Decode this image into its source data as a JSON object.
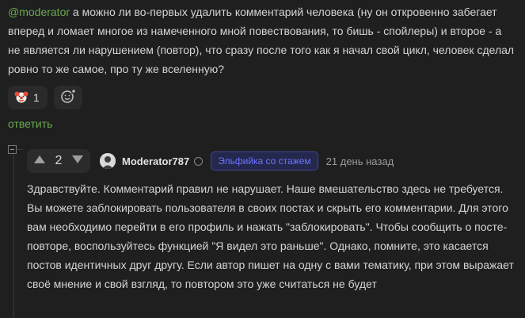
{
  "parent_comment": {
    "mention": "@moderator",
    "text": " а можно ли во-первых удалить комментарий человека (ну он откровенно забегает вперед и ломает многое из намеченного мной повествования, то бишь - спойлеры) и второе - а не является ли нарушением (повтор), что сразу после того как я начал свой цикл, человек сделал ровно то же самое, про ту же вселенную?",
    "reaction": {
      "icon": "clown-emoji",
      "count": "1"
    },
    "add_reaction_icon": "add-emoji-icon",
    "reply_label": "ответить"
  },
  "reply": {
    "votes": "2",
    "username": "Moderator787",
    "badge": "Эльфийка со стажем",
    "time": "21 день назад",
    "text": "Здравствуйте. Комментарий правил не нарушает. Наше вмешательство здесь не требуется. Вы можете заблокировать пользователя в своих постах и скрыть его комментарии. Для этого вам необходимо перейти в его профиль и нажать \"заблокировать\". Чтобы сообщить о посте-повторе, воспользуйтесь функцией \"Я видел это раньше\". Однако, помните, это касается постов идентичных друг другу. Если автор пишет на одну с вами тематику, при этом выражает своё мнение и свой взгляд, то повтором это уже считаться не будет"
  },
  "colors": {
    "background": "#1f1f1f",
    "link": "#6aa84f",
    "badge_text": "#6c74ff",
    "text": "#d4d4d4"
  }
}
